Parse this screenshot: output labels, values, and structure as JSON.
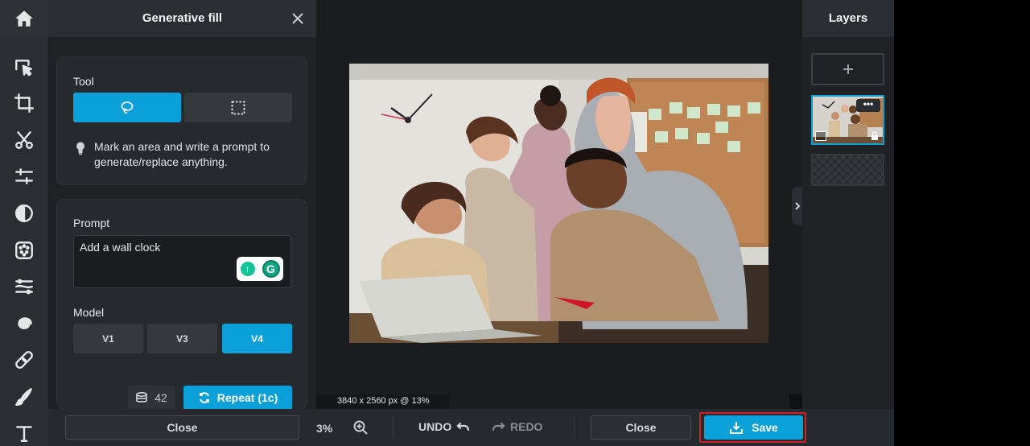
{
  "panel": {
    "title": "Generative fill",
    "tool_label": "Tool",
    "tool_options": [
      "lasso",
      "rectangle"
    ],
    "hint": "Mark an area and write a prompt to generate/replace anything.",
    "prompt_label": "Prompt",
    "prompt_value": "Add a wall clock",
    "model_label": "Model",
    "models": [
      "V1",
      "V3",
      "V4"
    ],
    "active_model": "V4",
    "credits": "42",
    "repeat_label": "Repeat (1c)"
  },
  "toolbar": {
    "icons": [
      "home-icon",
      "select-icon",
      "crop-icon",
      "cut-icon",
      "adjust-icon",
      "filter-icon",
      "effects-icon",
      "liquify-icon",
      "spiral-icon",
      "heal-icon",
      "brush-icon",
      "text-icon"
    ]
  },
  "canvas": {
    "dimensions": "3840 x 2560 px @ 13%"
  },
  "layers": {
    "title": "Layers",
    "thumb_menu": "•••"
  },
  "bottom": {
    "close_left": "Close",
    "zoom": "3%",
    "undo": "UNDO",
    "redo": "REDO",
    "close_right": "Close",
    "save": "Save"
  },
  "colors": {
    "accent": "#0ba0d8",
    "highlight": "#d0202e"
  }
}
